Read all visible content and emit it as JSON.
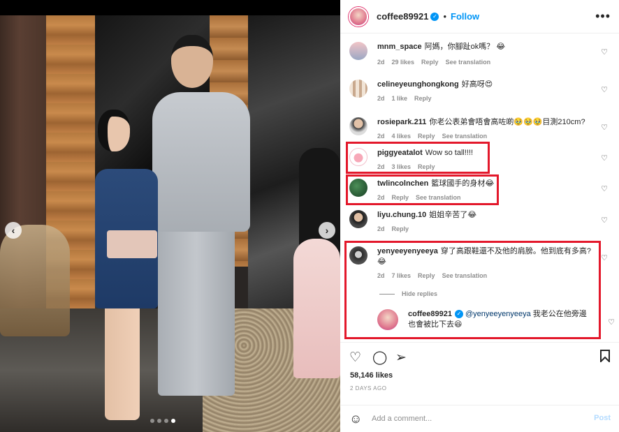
{
  "post": {
    "username": "coffee89921",
    "follow_label": "Follow",
    "more_label": "•••",
    "separator": "•"
  },
  "comments": [
    {
      "user": "mnm_space",
      "text": "阿媽，你腳趾ok嗎？ 😂",
      "age": "2d",
      "likes": "29 likes",
      "reply": "Reply",
      "translate": "See translation"
    },
    {
      "user": "celineyeunghongkong",
      "text": "好高呀😍",
      "age": "2d",
      "likes": "1 like",
      "reply": "Reply",
      "translate": ""
    },
    {
      "user": "rosiepark.211",
      "text": "你老公表弟會唔會高咗啲🥹🥹🥹目測210cm?",
      "age": "2d",
      "likes": "4 likes",
      "reply": "Reply",
      "translate": "See translation"
    },
    {
      "user": "piggyeatalot",
      "text": "Wow so tall!!!!",
      "age": "2d",
      "likes": "3 likes",
      "reply": "Reply",
      "translate": ""
    },
    {
      "user": "twlincolnchen",
      "text": "籃球國手的身材😂",
      "age": "2d",
      "likes": "",
      "reply": "Reply",
      "translate": "See translation"
    },
    {
      "user": "liyu.chung.10",
      "text": "姐姐辛苦了😂",
      "age": "2d",
      "likes": "",
      "reply": "Reply",
      "translate": ""
    },
    {
      "user": "yenyeeyenyeeya",
      "text": "穿了高跟鞋還不及他的肩膀。他到底有多高?😂",
      "age": "2d",
      "likes": "7 likes",
      "reply": "Reply",
      "translate": "See translation"
    }
  ],
  "replies": {
    "hide_label": "Hide replies",
    "user": "coffee89921",
    "mention": "@yenyeeyenyeeya",
    "text": " 我老公在他旁邊也會被比下去😆"
  },
  "stats": {
    "likes": "58,146 likes",
    "ago": "2 DAYS AGO"
  },
  "composer": {
    "placeholder": "Add a comment...",
    "post_label": "Post"
  },
  "icons": {
    "heart": "heart-icon",
    "comment": "comment-icon",
    "share": "share-icon",
    "save": "bookmark-icon",
    "emoji": "emoji-icon"
  },
  "carousel": {
    "total_slides": 4,
    "active_slide": 4
  },
  "colors": {
    "accent": "#0095f6",
    "highlight": "#e3182b"
  }
}
